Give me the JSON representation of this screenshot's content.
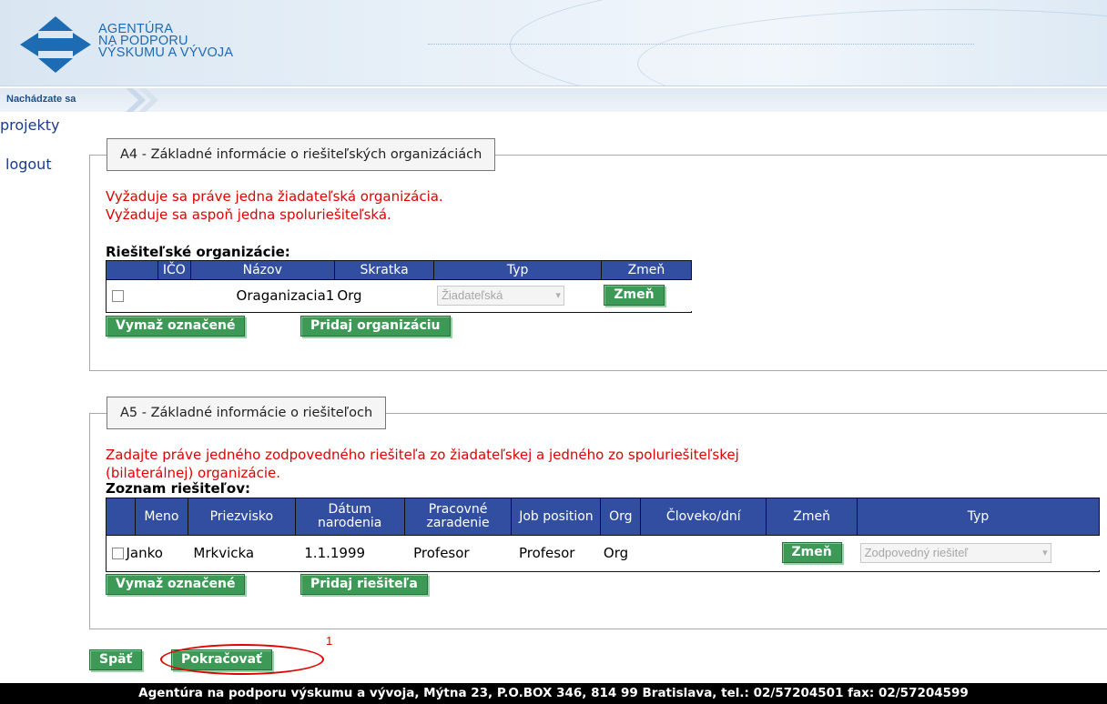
{
  "header": {
    "logo_lines": [
      "AGENTÚRA",
      "NA PODPORU",
      "VÝSKUMU A VÝVOJA"
    ],
    "breadcrumb_label": "Nachádzate sa"
  },
  "nav": {
    "projekty": "projekty",
    "logout": "logout"
  },
  "a4": {
    "legend": "A4 - Základné informácie o riešiteľských organizáciách",
    "errors": [
      "Vyžaduje sa práve jedna žiadateľská organizácia.",
      "Vyžaduje sa aspoň jedna spoluriešiteľská."
    ],
    "table_title": "Riešiteľské organizácie:",
    "columns": [
      "",
      "IČO",
      "Názov",
      "Skratka",
      "Typ",
      "Zmeň"
    ],
    "rows": [
      {
        "ico": "",
        "nazov": "Oraganizacia1",
        "skratka": "Org",
        "typ": "Žiadateľská",
        "zmen": "Zmeň"
      }
    ],
    "delete_button": "Vymaž označené",
    "add_button": "Pridaj organizáciu"
  },
  "a5": {
    "legend": "A5 - Základné informácie o riešiteľoch",
    "errors": [
      "Zadajte práve jedného zodpovedného riešiteľa zo žiadateľskej a jedného zo spoluriešiteľskej",
      "(bilaterálnej) organizácie."
    ],
    "table_title": "Zoznam riešiteľov:",
    "columns": [
      "",
      "Meno",
      "Priezvisko",
      "Dátum narodenia",
      "Pracovné zaradenie",
      "Job position",
      "Org",
      "Človeko/dní",
      "Zmeň",
      "Typ"
    ],
    "rows": [
      {
        "meno": "Janko",
        "priezvisko": "Mrkvicka",
        "datum": "1.1.1999",
        "zaradenie": "Profesor",
        "job": "Profesor",
        "org": "Org",
        "cloveko": "",
        "zmen": "Zmeň",
        "typ": "Zodpovedný riešiteľ"
      }
    ],
    "delete_button": "Vymaž označené",
    "add_button": "Pridaj riešiteľa"
  },
  "actions": {
    "back": "Späť",
    "continue": "Pokračovať",
    "annotation_number": "1"
  },
  "footer": "Agentúra na podporu výskumu a vývoja, Mýtna 23, P.O.BOX 346, 814 99 Bratislava, tel.: 02/57204501 fax: 02/57204599",
  "colors": {
    "table_header": "#324ea0",
    "button_green": "#3c9a56",
    "error_red": "#e00000",
    "link": "#1a3c8a",
    "logo_blue": "#1d6bb3"
  }
}
